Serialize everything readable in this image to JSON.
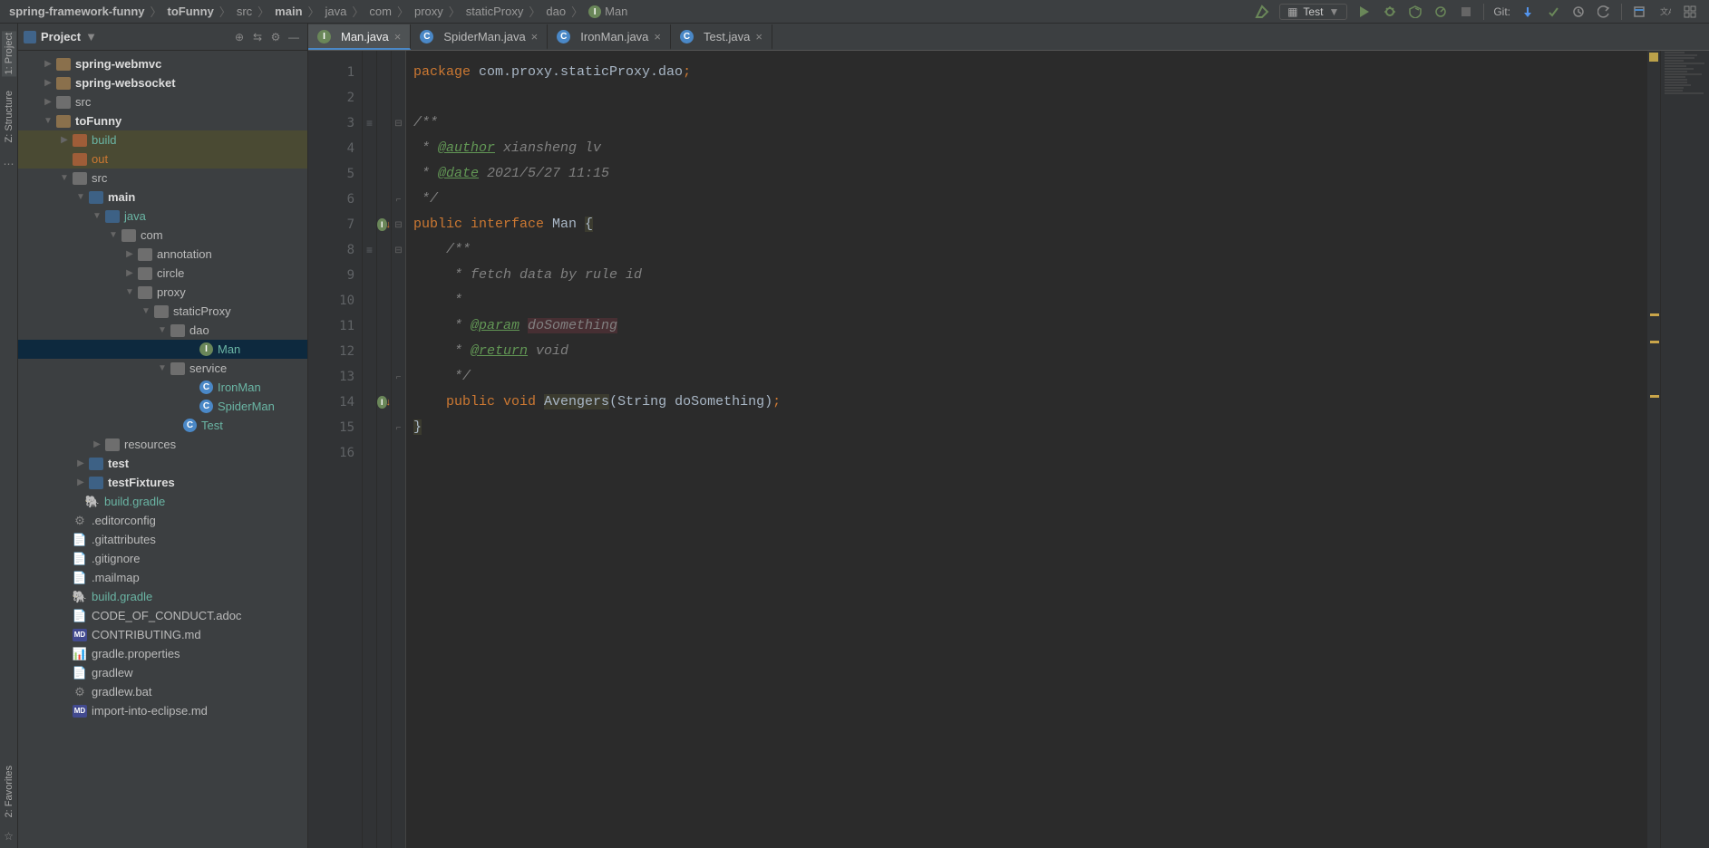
{
  "breadcrumb": [
    "spring-framework-funny",
    "toFunny",
    "src",
    "main",
    "java",
    "com",
    "proxy",
    "staticProxy",
    "dao",
    "Man"
  ],
  "breadcrumb_bold": [
    true,
    true,
    false,
    true,
    false,
    false,
    false,
    false,
    false,
    false
  ],
  "breadcrumb_last_icon": true,
  "toolbar": {
    "run_config": "Test",
    "git_label": "Git:"
  },
  "sidebar": {
    "title": "Project",
    "tree": [
      {
        "indent": 28,
        "tw": "▶",
        "ico": "folder",
        "lbl": "spring-webmvc",
        "bold": true
      },
      {
        "indent": 28,
        "tw": "▶",
        "ico": "folder",
        "lbl": "spring-websocket",
        "bold": true
      },
      {
        "indent": 28,
        "tw": "▶",
        "ico": "folder-grey",
        "lbl": "src"
      },
      {
        "indent": 28,
        "tw": "▼",
        "ico": "folder",
        "lbl": "toFunny",
        "bold": true
      },
      {
        "indent": 46,
        "tw": "▶",
        "ico": "folder-orange",
        "lbl": "build",
        "teal": true,
        "hl": "highlighted"
      },
      {
        "indent": 46,
        "tw": "",
        "ico": "folder-orange",
        "lbl": "out",
        "orange": true,
        "hl": "highlighted"
      },
      {
        "indent": 46,
        "tw": "▼",
        "ico": "folder-grey",
        "lbl": "src"
      },
      {
        "indent": 64,
        "tw": "▼",
        "ico": "folder-blue",
        "lbl": "main",
        "bold": true
      },
      {
        "indent": 82,
        "tw": "▼",
        "ico": "folder-blue",
        "lbl": "java",
        "teal": true
      },
      {
        "indent": 100,
        "tw": "▼",
        "ico": "folder-grey",
        "lbl": "com"
      },
      {
        "indent": 118,
        "tw": "▶",
        "ico": "folder-grey",
        "lbl": "annotation"
      },
      {
        "indent": 118,
        "tw": "▶",
        "ico": "folder-grey",
        "lbl": "circle"
      },
      {
        "indent": 118,
        "tw": "▼",
        "ico": "folder-grey",
        "lbl": "proxy"
      },
      {
        "indent": 136,
        "tw": "▼",
        "ico": "folder-grey",
        "lbl": "staticProxy"
      },
      {
        "indent": 154,
        "tw": "▼",
        "ico": "folder-grey",
        "lbl": "dao"
      },
      {
        "indent": 186,
        "tw": "",
        "ico": "java-i",
        "icoTxt": "I",
        "lbl": "Man",
        "teal": true,
        "hl": "selected"
      },
      {
        "indent": 154,
        "tw": "▼",
        "ico": "folder-grey",
        "lbl": "service"
      },
      {
        "indent": 186,
        "tw": "",
        "ico": "java-c",
        "icoTxt": "C",
        "lbl": "IronMan",
        "teal": true
      },
      {
        "indent": 186,
        "tw": "",
        "ico": "java-c",
        "icoTxt": "C",
        "lbl": "SpiderMan",
        "teal": true
      },
      {
        "indent": 168,
        "tw": "",
        "ico": "java-c",
        "icoTxt": "C",
        "lbl": "Test",
        "teal": true
      },
      {
        "indent": 82,
        "tw": "▶",
        "ico": "folder-grey",
        "lbl": "resources"
      },
      {
        "indent": 64,
        "tw": "▶",
        "ico": "folder-blue",
        "lbl": "test",
        "bold": true
      },
      {
        "indent": 64,
        "tw": "▶",
        "ico": "folder-blue",
        "lbl": "testFixtures",
        "bold": true
      },
      {
        "indent": 60,
        "tw": "",
        "ico": "file",
        "icoTxt": "🐘",
        "lbl": "build.gradle",
        "teal": true
      },
      {
        "indent": 46,
        "tw": "",
        "ico": "file",
        "icoTxt": "⚙",
        "lbl": ".editorconfig"
      },
      {
        "indent": 46,
        "tw": "",
        "ico": "file",
        "icoTxt": "📄",
        "lbl": ".gitattributes"
      },
      {
        "indent": 46,
        "tw": "",
        "ico": "file",
        "icoTxt": "📄",
        "lbl": ".gitignore"
      },
      {
        "indent": 46,
        "tw": "",
        "ico": "file",
        "icoTxt": "📄",
        "lbl": ".mailmap"
      },
      {
        "indent": 46,
        "tw": "",
        "ico": "file",
        "icoTxt": "🐘",
        "lbl": "build.gradle",
        "teal": true
      },
      {
        "indent": 46,
        "tw": "",
        "ico": "file",
        "icoTxt": "📄",
        "lbl": "CODE_OF_CONDUCT.adoc"
      },
      {
        "indent": 46,
        "tw": "",
        "ico": "md",
        "icoTxt": "MD",
        "lbl": "CONTRIBUTING.md"
      },
      {
        "indent": 46,
        "tw": "",
        "ico": "file",
        "icoTxt": "📊",
        "lbl": "gradle.properties"
      },
      {
        "indent": 46,
        "tw": "",
        "ico": "file",
        "icoTxt": "📄",
        "lbl": "gradlew"
      },
      {
        "indent": 46,
        "tw": "",
        "ico": "file",
        "icoTxt": "⚙",
        "lbl": "gradlew.bat"
      },
      {
        "indent": 46,
        "tw": "",
        "ico": "md",
        "icoTxt": "MD",
        "lbl": "import-into-eclipse.md"
      }
    ]
  },
  "left_tabs": [
    "1: Project",
    "Z: Structure",
    "2: Favorites"
  ],
  "tabs": [
    {
      "ico": "java-i",
      "icoTxt": "I",
      "label": "Man.java",
      "active": true
    },
    {
      "ico": "java-c",
      "icoTxt": "C",
      "label": "SpiderMan.java"
    },
    {
      "ico": "java-c",
      "icoTxt": "C",
      "label": "IronMan.java"
    },
    {
      "ico": "java-c",
      "icoTxt": "C",
      "label": "Test.java"
    }
  ],
  "gutter_numbers": [
    "1",
    "2",
    "3",
    "4",
    "5",
    "6",
    "7",
    "8",
    "9",
    "10",
    "11",
    "12",
    "13",
    "14",
    "15",
    "16"
  ],
  "gutter_marks": {
    "7": "impl",
    "14": "impl"
  },
  "gutter_struct": {
    "3": "≡",
    "8": "≡"
  },
  "code_lines": [
    [
      {
        "t": "package ",
        "c": "kw"
      },
      {
        "t": "com.proxy.staticProxy.dao",
        "c": "str"
      },
      {
        "t": ";",
        "c": "semi"
      }
    ],
    [],
    [
      {
        "t": "/**",
        "c": "comment"
      }
    ],
    [
      {
        "t": " * ",
        "c": "comment"
      },
      {
        "t": "@author",
        "c": "doctag"
      },
      {
        "t": " xiansheng lv",
        "c": "comment"
      }
    ],
    [
      {
        "t": " * ",
        "c": "comment"
      },
      {
        "t": "@date",
        "c": "doctag"
      },
      {
        "t": " 2021/5/27 11:15",
        "c": "comment"
      }
    ],
    [
      {
        "t": " */",
        "c": "comment"
      }
    ],
    [
      {
        "t": "public ",
        "c": "kw"
      },
      {
        "t": "interface ",
        "c": "kw"
      },
      {
        "t": "Man ",
        "c": "str"
      },
      {
        "t": "{",
        "c": "str",
        "bg": "method-hl"
      }
    ],
    [
      {
        "t": "    /**",
        "c": "comment"
      }
    ],
    [
      {
        "t": "     * fetch data by rule id",
        "c": "comment"
      }
    ],
    [
      {
        "t": "     *",
        "c": "comment"
      }
    ],
    [
      {
        "t": "     * ",
        "c": "comment"
      },
      {
        "t": "@param",
        "c": "doctag"
      },
      {
        "t": " ",
        "c": "comment"
      },
      {
        "t": "doSomething",
        "c": "param-hl"
      }
    ],
    [
      {
        "t": "     * ",
        "c": "comment"
      },
      {
        "t": "@return",
        "c": "doctag"
      },
      {
        "t": " void",
        "c": "comment"
      }
    ],
    [
      {
        "t": "     */",
        "c": "comment"
      }
    ],
    [
      {
        "t": "    public ",
        "c": "kw"
      },
      {
        "t": "void ",
        "c": "kw"
      },
      {
        "t": "Avengers",
        "c": "str",
        "bg": "method-hl"
      },
      {
        "t": "(String doSomething)",
        "c": "str"
      },
      {
        "t": ";",
        "c": "semi"
      }
    ],
    [
      {
        "t": "}",
        "c": "str",
        "bg": "method-hl"
      }
    ],
    []
  ],
  "right_marks": [
    290,
    320,
    380
  ]
}
